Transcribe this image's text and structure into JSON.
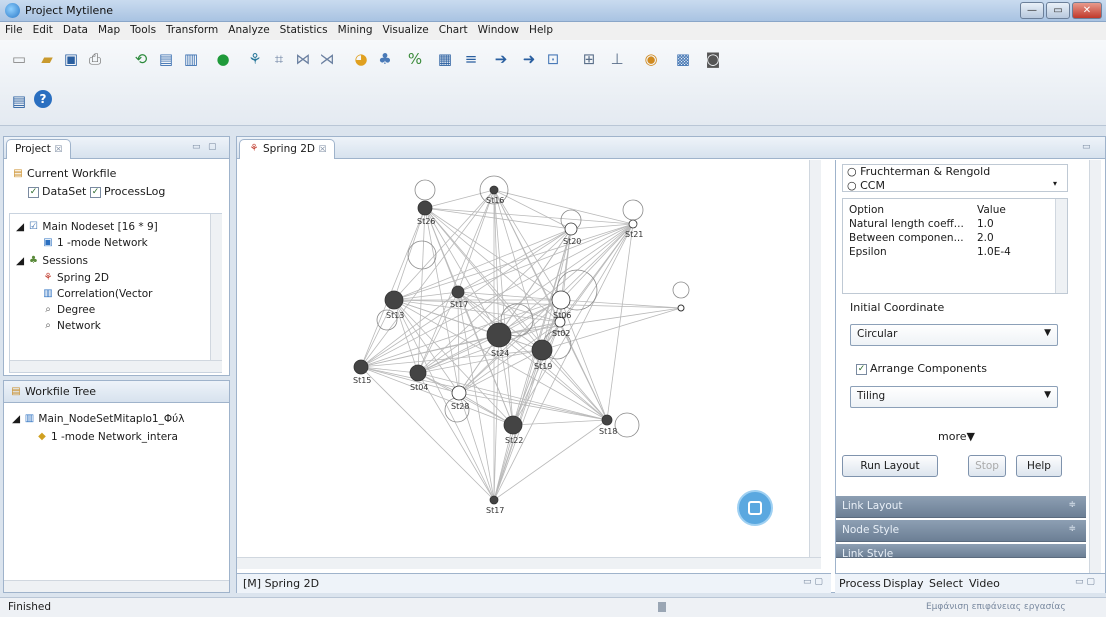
{
  "window": {
    "title": "Project Mytilene"
  },
  "menu": [
    "File",
    "Edit",
    "Data",
    "Map",
    "Tools",
    "Transform",
    "Analyze",
    "Statistics",
    "Mining",
    "Visualize",
    "Chart",
    "Window",
    "Help"
  ],
  "project_panel": {
    "tab": "Project",
    "tab_suffix": "☒",
    "current_workfile": "Current Workfile",
    "checks": [
      "DataSet",
      "ProcessLog"
    ],
    "tree": [
      {
        "label": "Main Nodeset [16 * 9]",
        "icon": "checked-node-icon"
      },
      {
        "label": "1 -mode Network",
        "icon": "network-icon"
      },
      {
        "label": "Sessions",
        "icon": "sessions-icon"
      },
      {
        "label": "Spring 2D",
        "icon": "spring-icon"
      },
      {
        "label": "Correlation(Vector",
        "icon": "bar-chart-icon"
      },
      {
        "label": "Degree",
        "icon": "magnifier-icon"
      },
      {
        "label": "Network",
        "icon": "magnifier-icon"
      }
    ]
  },
  "workfile_tree": {
    "title": "Workfile Tree",
    "items": [
      "Main_NodeSetMitaplo1_Φύλ",
      "1 -mode Network_intera"
    ]
  },
  "editor": {
    "tab": "Spring 2D",
    "bottom_tab": "[M] Spring 2D",
    "nodes": [
      {
        "id": "St16",
        "fill": "dark"
      },
      {
        "id": "St26",
        "fill": "dark"
      },
      {
        "id": "St20",
        "fill": "open"
      },
      {
        "id": "St21",
        "fill": "open"
      },
      {
        "id": "St13",
        "fill": "dark"
      },
      {
        "id": "St17",
        "fill": "dark"
      },
      {
        "id": "St06",
        "fill": "open"
      },
      {
        "id": "St02",
        "fill": "open"
      },
      {
        "id": "St24",
        "fill": "dark"
      },
      {
        "id": "St19",
        "fill": "dark"
      },
      {
        "id": "St15",
        "fill": "dark"
      },
      {
        "id": "St04",
        "fill": "dark"
      },
      {
        "id": "St28",
        "fill": "open"
      },
      {
        "id": "St22",
        "fill": "dark"
      },
      {
        "id": "St18",
        "fill": "dark"
      },
      {
        "id": "St17",
        "fill": "dark"
      }
    ]
  },
  "layout_panel": {
    "algorithms": [
      "Fruchterman & Rengold",
      "CCM"
    ],
    "options_header": [
      "Option",
      "Value"
    ],
    "options": [
      [
        "Natural length coeff...",
        "1.0"
      ],
      [
        "Between componen...",
        "2.0"
      ],
      [
        "Epsilon",
        "1.0E-4"
      ]
    ],
    "initial_coordinate_label": "Initial Coordinate",
    "initial_coordinate": "Circular",
    "arrange_components": "Arrange Components",
    "arrange_mode": "Tiling",
    "more": "more▼",
    "run_layout": "Run Layout",
    "stop": "Stop",
    "help": "Help",
    "sections": [
      "Link Layout",
      "Node Style",
      "Link Style"
    ],
    "tabs": [
      "Process",
      "Display",
      "Select",
      "Video"
    ]
  },
  "status": {
    "left": "Finished",
    "right": "Εμφάνιση επιφάνειας εργασίας"
  }
}
